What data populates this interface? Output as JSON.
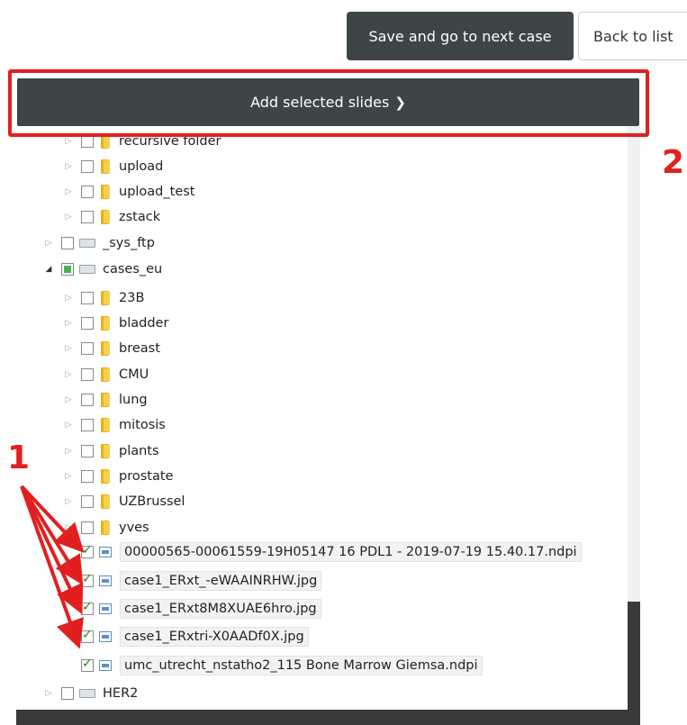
{
  "header": {
    "save_next_label": "Save and go to next case",
    "back_label": "Back to list"
  },
  "add_bar": {
    "label": "Add selected slides",
    "chevron": "❯"
  },
  "tree": {
    "partial_top": {
      "label": "recursive folder"
    },
    "top_folders": [
      {
        "label": "upload"
      },
      {
        "label": "upload_test"
      },
      {
        "label": "zstack"
      }
    ],
    "drives": {
      "sys_ftp": {
        "label": "_sys_ftp"
      },
      "cases_eu": {
        "label": "cases_eu"
      },
      "her2": {
        "label": "HER2"
      }
    },
    "cases_eu_folders": [
      {
        "label": "23B"
      },
      {
        "label": "bladder"
      },
      {
        "label": "breast"
      },
      {
        "label": "CMU"
      },
      {
        "label": "lung"
      },
      {
        "label": "mitosis"
      },
      {
        "label": "plants"
      },
      {
        "label": "prostate"
      },
      {
        "label": "UZBrussel"
      },
      {
        "label": "yves"
      }
    ],
    "files": [
      {
        "label": "00000565-00061559-19H05147 16 PDL1 - 2019-07-19 15.40.17.ndpi",
        "checked": true
      },
      {
        "label": "case1_ERxt_-eWAAINRHW.jpg",
        "checked": true
      },
      {
        "label": "case1_ERxt8M8XUAE6hro.jpg",
        "checked": true
      },
      {
        "label": "case1_ERxtri-X0AADf0X.jpg",
        "checked": true
      },
      {
        "label": "umc_utrecht_nstatho2_115 Bone Marrow Giemsa.ndpi",
        "checked": true
      }
    ]
  },
  "annotations": {
    "label_1": "1",
    "label_2": "2",
    "color": "#e21f1f"
  },
  "icons": [
    "expand-arrow-icon",
    "collapse-arrow-icon",
    "folder-icon",
    "drive-icon",
    "image-file-icon",
    "chevron-right-icon"
  ]
}
